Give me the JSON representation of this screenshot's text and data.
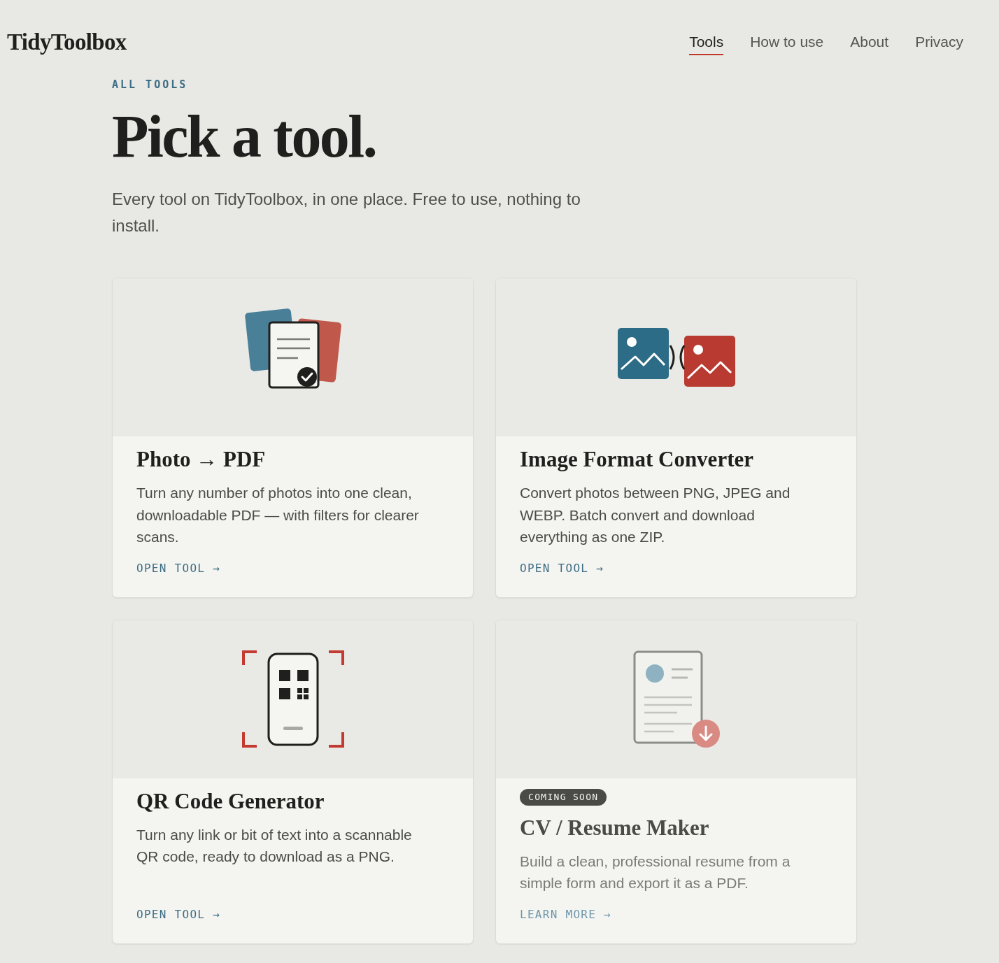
{
  "header": {
    "logo": "TidyToolbox",
    "nav": [
      {
        "label": "Tools",
        "selected": true
      },
      {
        "label": "How to use",
        "selected": false
      },
      {
        "label": "About",
        "selected": false
      },
      {
        "label": "Privacy",
        "selected": false
      }
    ]
  },
  "intro": {
    "eyebrow": "ALL TOOLS",
    "title": "Pick a tool.",
    "subtitle": "Every tool on TidyToolbox, in one place. Free to use, nothing to install."
  },
  "cards": [
    {
      "kind": "pdf",
      "title": "Photo → PDF",
      "description": "Turn any number of photos into one clean, downloadable PDF — with filters for clearer scans.",
      "link": "OPEN TOOL →",
      "muted": false
    },
    {
      "kind": "convert",
      "title": "Image Format Converter",
      "description": "Convert photos between PNG, JPEG and WEBP. Batch convert and download everything as one ZIP.",
      "link": "OPEN TOOL →",
      "muted": false
    },
    {
      "kind": "qr",
      "title": "QR Code Generator",
      "description": "Turn any link or bit of text into a scannable QR code, ready to download as a PNG.",
      "link": "OPEN TOOL →",
      "muted": false
    },
    {
      "kind": "resume",
      "badge": "COMING SOON",
      "title": "CV / Resume Maker",
      "description": "Build a clean, professional resume from a simple form and export it as a PDF.",
      "link": "LEARN MORE →",
      "muted": true
    }
  ]
}
